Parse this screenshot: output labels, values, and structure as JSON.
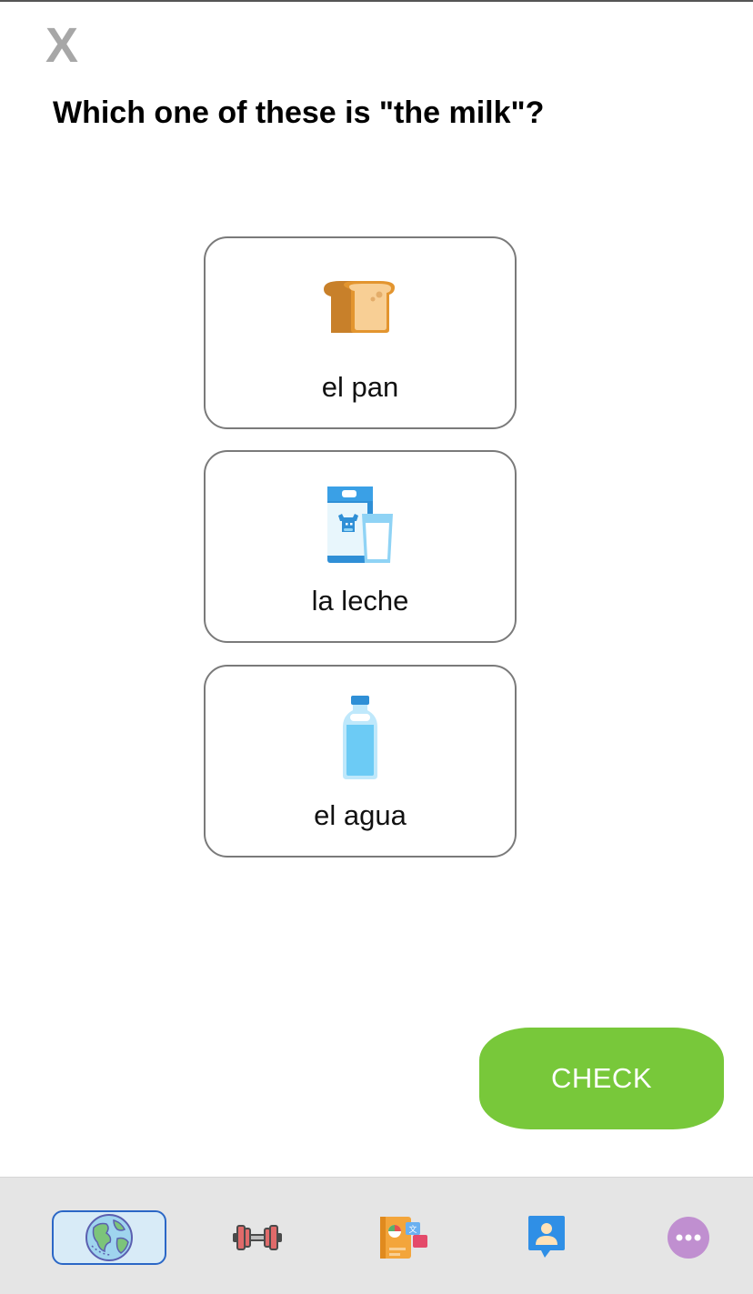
{
  "header": {
    "close_label": "X",
    "prompt": "Which one of these is \"the milk\"?"
  },
  "choices": [
    {
      "label": "el pan",
      "icon": "bread-icon"
    },
    {
      "label": "la leche",
      "icon": "milk-carton-icon"
    },
    {
      "label": "el agua",
      "icon": "water-bottle-icon"
    }
  ],
  "actions": {
    "check_label": "CHECK"
  },
  "tabbar": {
    "items": [
      {
        "icon": "globe-icon",
        "selected": true
      },
      {
        "icon": "dumbbell-icon",
        "selected": false
      },
      {
        "icon": "dictionary-icon",
        "selected": false
      },
      {
        "icon": "profile-icon",
        "selected": false
      },
      {
        "icon": "more-icon",
        "selected": false
      }
    ]
  },
  "colors": {
    "check_button": "#78c83a",
    "selected_tab_border": "#2b67c6",
    "selected_tab_fill": "#d8ebf7",
    "close_x": "#a7a7a7",
    "tabbar_background": "#e5e5e5"
  }
}
